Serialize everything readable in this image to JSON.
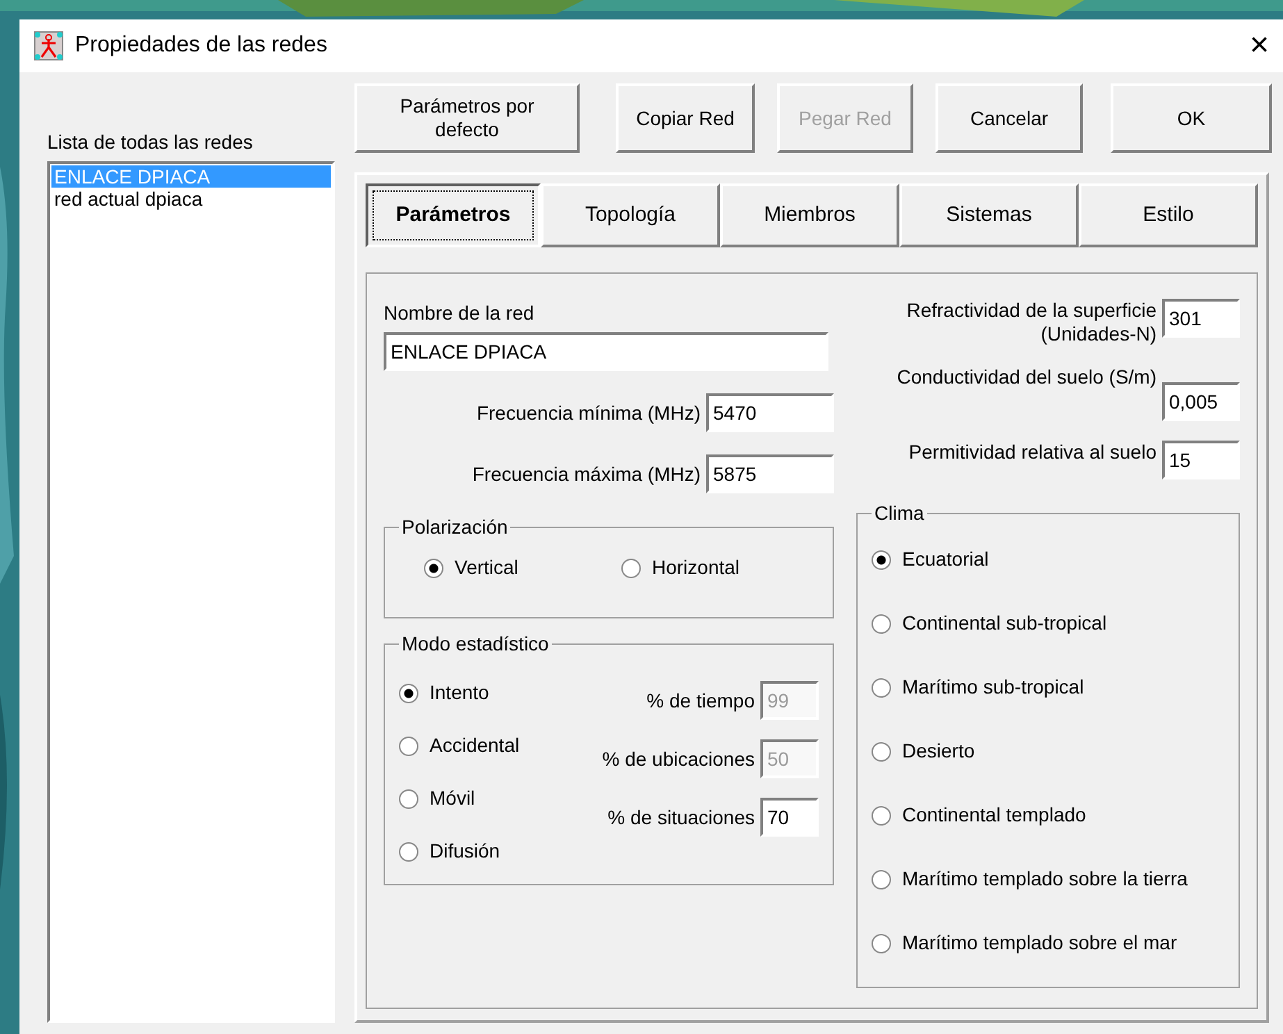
{
  "window": {
    "title": "Propiedades de las redes",
    "close": "×"
  },
  "networks": {
    "label": "Lista de todas las redes",
    "items": [
      {
        "name": "ENLACE DPIACA",
        "selected": true
      },
      {
        "name": "red actual dpiaca",
        "selected": false
      }
    ]
  },
  "buttons": [
    {
      "label": "Parámetros por defecto",
      "disabled": false
    },
    {
      "label": "Copiar Red",
      "disabled": false
    },
    {
      "label": "Pegar Red",
      "disabled": true
    },
    {
      "label": "Cancelar",
      "disabled": false
    },
    {
      "label": "OK",
      "disabled": false
    }
  ],
  "tabs": [
    {
      "label": "Parámetros",
      "selected": true
    },
    {
      "label": "Topología",
      "selected": false
    },
    {
      "label": "Miembros",
      "selected": false
    },
    {
      "label": "Sistemas",
      "selected": false
    },
    {
      "label": "Estilo",
      "selected": false
    }
  ],
  "network_name": {
    "label": "Nombre de la red",
    "value": "ENLACE DPIACA"
  },
  "frequencies": [
    {
      "label": "Frecuencia mínima (MHz)",
      "value": "5470"
    },
    {
      "label": "Frecuencia máxima (MHz)",
      "value": "5875"
    }
  ],
  "ground": [
    {
      "label": "Refractividad de la superficie (Unidades-N)",
      "value": "301"
    },
    {
      "label": "Conductividad del suelo (S/m)",
      "value": "0,005"
    },
    {
      "label": "Permitividad relativa al suelo",
      "value": "15"
    }
  ],
  "polarization": {
    "title": "Polarización",
    "options": [
      {
        "label": "Vertical",
        "selected": true
      },
      {
        "label": "Horizontal",
        "selected": false
      }
    ]
  },
  "statistical_mode": {
    "title": "Modo estadístico",
    "options": [
      {
        "label": "Intento",
        "selected": true
      },
      {
        "label": "Accidental",
        "selected": false
      },
      {
        "label": "Móvil",
        "selected": false
      },
      {
        "label": "Difusión",
        "selected": false
      }
    ],
    "fields": [
      {
        "label": "% de tiempo",
        "value": "99",
        "disabled": true
      },
      {
        "label": "% de ubicaciones",
        "value": "50",
        "disabled": true
      },
      {
        "label": "% de situaciones",
        "value": "70",
        "disabled": false
      }
    ]
  },
  "climate": {
    "title": "Clima",
    "options": [
      {
        "label": "Ecuatorial",
        "selected": true
      },
      {
        "label": "Continental sub-tropical",
        "selected": false
      },
      {
        "label": "Marítimo sub-tropical",
        "selected": false
      },
      {
        "label": "Desierto",
        "selected": false
      },
      {
        "label": "Continental templado",
        "selected": false
      },
      {
        "label": "Marítimo templado sobre la tierra",
        "selected": false
      },
      {
        "label": "Marítimo templado sobre el mar",
        "selected": false
      }
    ]
  }
}
